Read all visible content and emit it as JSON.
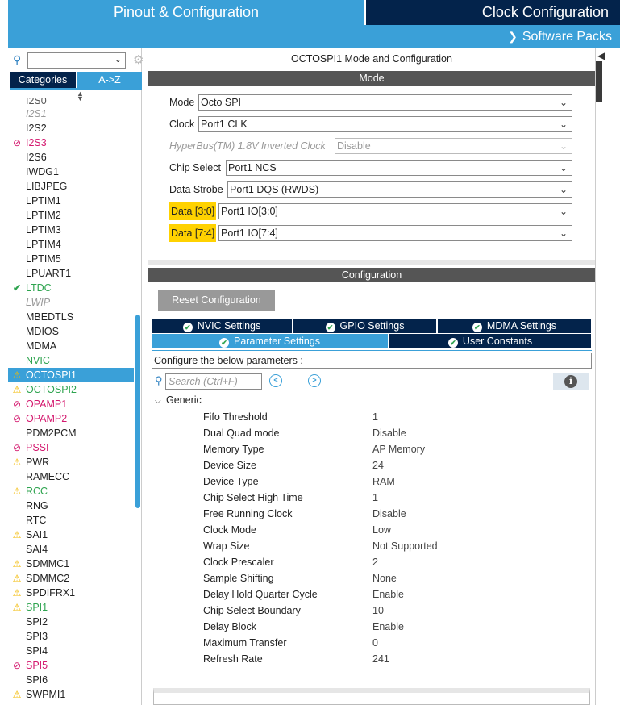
{
  "header": {
    "tab_pinout": "Pinout & Configuration",
    "tab_clock": "Clock Configuration",
    "software_packs": "Software Packs"
  },
  "sidebar": {
    "tabs": [
      "Categories",
      "A->Z"
    ],
    "items": [
      {
        "label": "I2S1",
        "state": "disabled"
      },
      {
        "label": "I2S2",
        "state": "normal"
      },
      {
        "label": "I2S3",
        "state": "error"
      },
      {
        "label": "I2S6",
        "state": "normal"
      },
      {
        "label": "IWDG1",
        "state": "normal"
      },
      {
        "label": "LIBJPEG",
        "state": "normal"
      },
      {
        "label": "LPTIM1",
        "state": "normal"
      },
      {
        "label": "LPTIM2",
        "state": "normal"
      },
      {
        "label": "LPTIM3",
        "state": "normal"
      },
      {
        "label": "LPTIM4",
        "state": "normal"
      },
      {
        "label": "LPTIM5",
        "state": "normal"
      },
      {
        "label": "LPUART1",
        "state": "normal"
      },
      {
        "label": "LTDC",
        "state": "ok"
      },
      {
        "label": "LWIP",
        "state": "disabled"
      },
      {
        "label": "MBEDTLS",
        "state": "normal"
      },
      {
        "label": "MDIOS",
        "state": "normal"
      },
      {
        "label": "MDMA",
        "state": "normal"
      },
      {
        "label": "NVIC",
        "state": "okplain"
      },
      {
        "label": "OCTOSPI1",
        "state": "selected"
      },
      {
        "label": "OCTOSPI2",
        "state": "warnok"
      },
      {
        "label": "OPAMP1",
        "state": "error"
      },
      {
        "label": "OPAMP2",
        "state": "error"
      },
      {
        "label": "PDM2PCM",
        "state": "normal"
      },
      {
        "label": "PSSI",
        "state": "error"
      },
      {
        "label": "PWR",
        "state": "warn"
      },
      {
        "label": "RAMECC",
        "state": "normal"
      },
      {
        "label": "RCC",
        "state": "warnok"
      },
      {
        "label": "RNG",
        "state": "normal"
      },
      {
        "label": "RTC",
        "state": "normal"
      },
      {
        "label": "SAI1",
        "state": "warn"
      },
      {
        "label": "SAI4",
        "state": "normal"
      },
      {
        "label": "SDMMC1",
        "state": "warn"
      },
      {
        "label": "SDMMC2",
        "state": "warn"
      },
      {
        "label": "SPDIFRX1",
        "state": "warn"
      },
      {
        "label": "SPI1",
        "state": "warnok"
      },
      {
        "label": "SPI2",
        "state": "normal"
      },
      {
        "label": "SPI3",
        "state": "normal"
      },
      {
        "label": "SPI4",
        "state": "normal"
      },
      {
        "label": "SPI5",
        "state": "error"
      },
      {
        "label": "SPI6",
        "state": "normal"
      },
      {
        "label": "SWPMI1",
        "state": "warn"
      }
    ]
  },
  "main": {
    "title": "OCTOSPI1 Mode and Configuration",
    "mode_band": "Mode",
    "config_band": "Configuration",
    "mode_rows": [
      {
        "label": "Mode",
        "value": "Octo SPI",
        "highlight": false,
        "disabled": false
      },
      {
        "label": "Clock",
        "value": "Port1 CLK",
        "highlight": false,
        "disabled": false
      },
      {
        "label": "HyperBus(TM) 1.8V Inverted Clock",
        "value": "Disable",
        "highlight": false,
        "disabled": true
      },
      {
        "label": "Chip Select",
        "value": "Port1 NCS",
        "highlight": false,
        "disabled": false
      },
      {
        "label": "Data Strobe",
        "value": "Port1 DQS (RWDS)",
        "highlight": false,
        "disabled": false
      },
      {
        "label": "Data [3:0]",
        "value": "Port1 IO[3:0]",
        "highlight": true,
        "disabled": false
      },
      {
        "label": "Data [7:4]",
        "value": "Port1 IO[7:4]",
        "highlight": true,
        "disabled": false
      }
    ],
    "reset_button": "Reset Configuration",
    "tabs_row1": [
      "NVIC Settings",
      "GPIO Settings",
      "MDMA Settings"
    ],
    "tabs_row2": [
      "Parameter Settings",
      "User Constants"
    ],
    "configure_text": "Configure the below parameters :",
    "search_placeholder": "Search (Ctrl+F)",
    "group_label": "Generic",
    "params": [
      {
        "name": "Fifo Threshold",
        "value": "1"
      },
      {
        "name": "Dual Quad mode",
        "value": "Disable"
      },
      {
        "name": "Memory Type",
        "value": "AP Memory"
      },
      {
        "name": "Device Size",
        "value": "24"
      },
      {
        "name": "Device Type",
        "value": "RAM"
      },
      {
        "name": "Chip Select High Time",
        "value": "1"
      },
      {
        "name": "Free Running Clock",
        "value": "Disable"
      },
      {
        "name": "Clock Mode",
        "value": "Low"
      },
      {
        "name": "Wrap Size",
        "value": "Not Supported"
      },
      {
        "name": "Clock Prescaler",
        "value": "2"
      },
      {
        "name": "Sample Shifting",
        "value": "None"
      },
      {
        "name": "Delay Hold Quarter Cycle",
        "value": "Enable"
      },
      {
        "name": "Chip Select Boundary",
        "value": "10"
      },
      {
        "name": "Delay Block",
        "value": "Enable"
      },
      {
        "name": "Maximum Transfer",
        "value": "0"
      },
      {
        "name": "Refresh Rate",
        "value": "241"
      }
    ]
  },
  "colors": {
    "accent_blue": "#3aa0d8",
    "dark_navy": "#03234b",
    "warning": "#f2b900",
    "error": "#d4186e",
    "ok": "#2ea44f"
  }
}
